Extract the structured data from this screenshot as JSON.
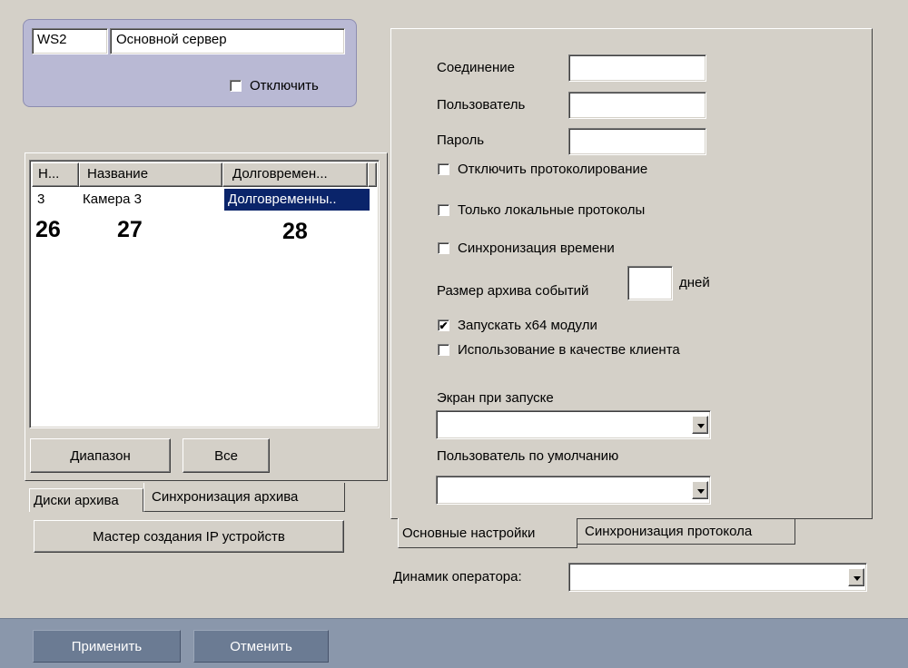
{
  "server": {
    "id": "WS2",
    "name": "Основной сервер",
    "disable_label": "Отключить"
  },
  "table": {
    "columns": [
      "Н...",
      "Название",
      "Долговремен..."
    ],
    "rows": [
      {
        "num": "3",
        "name": "Камера 3",
        "type": "Долговременны.."
      }
    ],
    "annotations": [
      "26",
      "27",
      "28"
    ]
  },
  "buttons": {
    "range": "Диапазон",
    "all": "Все",
    "ip_wizard": "Мастер создания IP устройств",
    "apply": "Применить",
    "cancel": "Отменить"
  },
  "left_tabs": {
    "disks": "Диски архива",
    "sync": "Синхронизация архива"
  },
  "settings": {
    "connection_label": "Соединение",
    "user_label": "Пользователь",
    "password_label": "Пароль",
    "connection_value": "",
    "user_value": "",
    "password_value": "",
    "disable_logging": "Отключить протоколирование",
    "local_protocols": "Только локальные протоколы",
    "time_sync": "Синхронизация времени",
    "archive_size_label": "Размер архива событий",
    "archive_size_value": "",
    "days": "дней",
    "run_x64": "Запускать x64 модули",
    "use_as_client": "Использование в качестве клиента",
    "startup_screen_label": "Экран при запуске",
    "startup_screen_value": "",
    "default_user_label": "Пользователь по умолчанию",
    "default_user_value": ""
  },
  "right_tabs": {
    "main": "Основные настройки",
    "sync_protocol": "Синхронизация протокола"
  },
  "operator_speaker": {
    "label": "Динамик оператора:",
    "value": ""
  },
  "colors": {
    "face": "#d4d0c8",
    "selection": "#0a246a",
    "bottombar": "#8a97ab",
    "group_box": "#b4b4d0"
  }
}
